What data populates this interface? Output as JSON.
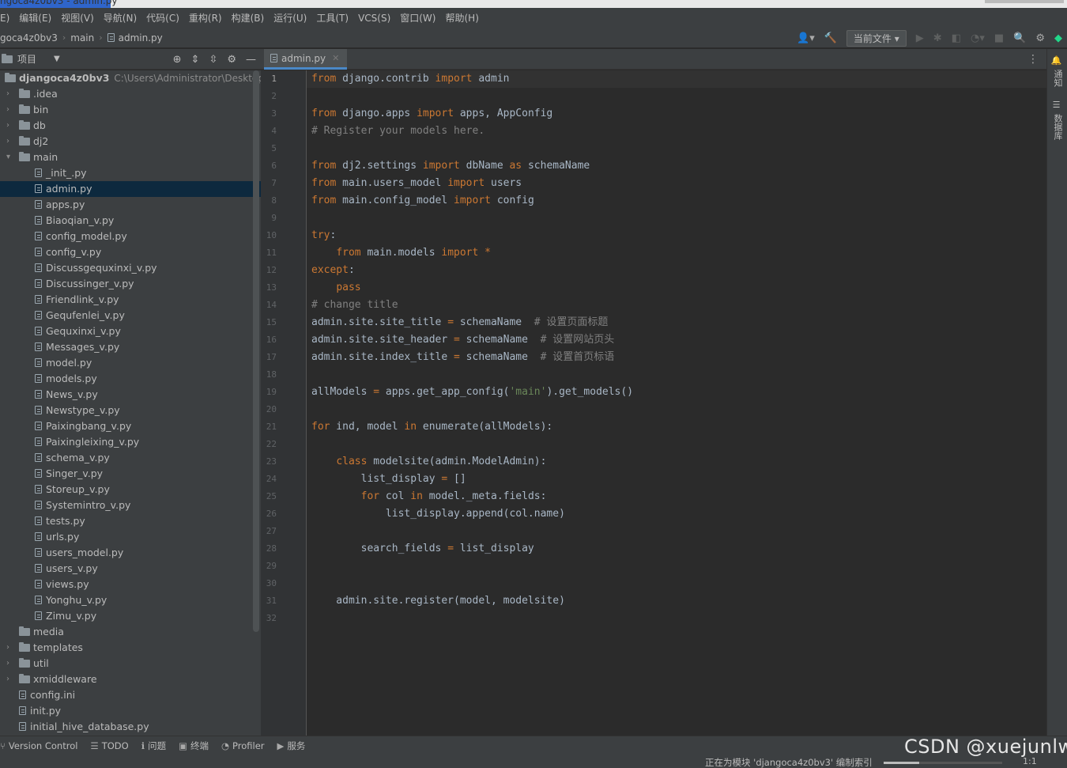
{
  "window": {
    "title": "ngoca4z0bv3 - admin.py"
  },
  "menu": [
    "E)",
    "编辑(E)",
    "视图(V)",
    "导航(N)",
    "代码(C)",
    "重构(R)",
    "构建(B)",
    "运行(U)",
    "工具(T)",
    "VCS(S)",
    "窗口(W)",
    "帮助(H)"
  ],
  "breadcrumb": {
    "project": "goca4z0bv3",
    "folder": "main",
    "file": "admin.py"
  },
  "toolbar": {
    "run_config": "当前文件"
  },
  "project_panel": {
    "title": "项目",
    "tree": [
      {
        "label": "djangoca4z0bv3",
        "path": "C:\\Users\\Administrator\\Desktop\\",
        "type": "root",
        "depth": 0,
        "arrow": "▾"
      },
      {
        "label": ".idea",
        "type": "folder",
        "depth": 1,
        "arrow": "›"
      },
      {
        "label": "bin",
        "type": "folder",
        "depth": 1,
        "arrow": "›"
      },
      {
        "label": "db",
        "type": "folder",
        "depth": 1,
        "arrow": "›"
      },
      {
        "label": "dj2",
        "type": "folder",
        "depth": 1,
        "arrow": "›"
      },
      {
        "label": "main",
        "type": "folder",
        "depth": 1,
        "arrow": "▾"
      },
      {
        "label": "_init_.py",
        "type": "file",
        "depth": 2
      },
      {
        "label": "admin.py",
        "type": "file",
        "depth": 2,
        "selected": true
      },
      {
        "label": "apps.py",
        "type": "file",
        "depth": 2
      },
      {
        "label": "Biaoqian_v.py",
        "type": "file",
        "depth": 2
      },
      {
        "label": "config_model.py",
        "type": "file",
        "depth": 2
      },
      {
        "label": "config_v.py",
        "type": "file",
        "depth": 2
      },
      {
        "label": "Discussgequxinxi_v.py",
        "type": "file",
        "depth": 2
      },
      {
        "label": "Discussinger_v.py",
        "type": "file",
        "depth": 2
      },
      {
        "label": "Friendlink_v.py",
        "type": "file",
        "depth": 2
      },
      {
        "label": "Gequfenlei_v.py",
        "type": "file",
        "depth": 2
      },
      {
        "label": "Gequxinxi_v.py",
        "type": "file",
        "depth": 2
      },
      {
        "label": "Messages_v.py",
        "type": "file",
        "depth": 2
      },
      {
        "label": "model.py",
        "type": "file",
        "depth": 2
      },
      {
        "label": "models.py",
        "type": "file",
        "depth": 2
      },
      {
        "label": "News_v.py",
        "type": "file",
        "depth": 2
      },
      {
        "label": "Newstype_v.py",
        "type": "file",
        "depth": 2
      },
      {
        "label": "Paixingbang_v.py",
        "type": "file",
        "depth": 2
      },
      {
        "label": "Paixingleixing_v.py",
        "type": "file",
        "depth": 2
      },
      {
        "label": "schema_v.py",
        "type": "file",
        "depth": 2
      },
      {
        "label": "Singer_v.py",
        "type": "file",
        "depth": 2
      },
      {
        "label": "Storeup_v.py",
        "type": "file",
        "depth": 2
      },
      {
        "label": "Systemintro_v.py",
        "type": "file",
        "depth": 2
      },
      {
        "label": "tests.py",
        "type": "file",
        "depth": 2
      },
      {
        "label": "urls.py",
        "type": "file",
        "depth": 2
      },
      {
        "label": "users_model.py",
        "type": "file",
        "depth": 2
      },
      {
        "label": "users_v.py",
        "type": "file",
        "depth": 2
      },
      {
        "label": "views.py",
        "type": "file",
        "depth": 2
      },
      {
        "label": "Yonghu_v.py",
        "type": "file",
        "depth": 2
      },
      {
        "label": "Zimu_v.py",
        "type": "file",
        "depth": 2
      },
      {
        "label": "media",
        "type": "folder",
        "depth": 1
      },
      {
        "label": "templates",
        "type": "folder",
        "depth": 1,
        "arrow": "›"
      },
      {
        "label": "util",
        "type": "folder",
        "depth": 1,
        "arrow": "›"
      },
      {
        "label": "xmiddleware",
        "type": "folder",
        "depth": 1,
        "arrow": "›"
      },
      {
        "label": "config.ini",
        "type": "file",
        "depth": 1
      },
      {
        "label": "init.py",
        "type": "file",
        "depth": 1
      },
      {
        "label": "initial_hive_database.py",
        "type": "file",
        "depth": 1
      }
    ]
  },
  "editor": {
    "tab": "admin.py",
    "current_line": 1,
    "lines": [
      [
        [
          "kw",
          "from"
        ],
        [
          "t",
          " django.contrib "
        ],
        [
          "kw",
          "import"
        ],
        [
          "t",
          " admin"
        ]
      ],
      [],
      [
        [
          "kw",
          "from"
        ],
        [
          "t",
          " django.apps "
        ],
        [
          "kw",
          "import"
        ],
        [
          "t",
          " apps, AppConfig"
        ]
      ],
      [
        [
          "cm",
          "# Register your models here."
        ]
      ],
      [],
      [
        [
          "kw",
          "from"
        ],
        [
          "t",
          " dj2.settings "
        ],
        [
          "kw",
          "import"
        ],
        [
          "t",
          " dbName "
        ],
        [
          "kw",
          "as"
        ],
        [
          "t",
          " schemaName"
        ]
      ],
      [
        [
          "kw",
          "from"
        ],
        [
          "t",
          " main.users_model "
        ],
        [
          "kw",
          "import"
        ],
        [
          "t",
          " users"
        ]
      ],
      [
        [
          "kw",
          "from"
        ],
        [
          "t",
          " main.config_model "
        ],
        [
          "kw",
          "import"
        ],
        [
          "t",
          " config"
        ]
      ],
      [],
      [
        [
          "kw",
          "try"
        ],
        [
          "t",
          ":"
        ]
      ],
      [
        [
          "t",
          "    "
        ],
        [
          "kw",
          "from"
        ],
        [
          "t",
          " main.models "
        ],
        [
          "kw",
          "import"
        ],
        [
          "t",
          " "
        ],
        [
          "kw",
          "*"
        ]
      ],
      [
        [
          "kw",
          "except"
        ],
        [
          "t",
          ":"
        ]
      ],
      [
        [
          "t",
          "    "
        ],
        [
          "kw",
          "pass"
        ]
      ],
      [
        [
          "cm",
          "# change title"
        ]
      ],
      [
        [
          "t",
          "admin.site.site_title "
        ],
        [
          "kw",
          "="
        ],
        [
          "t",
          " schemaName  "
        ],
        [
          "cm",
          "# 设置页面标题"
        ]
      ],
      [
        [
          "t",
          "admin.site.site_header "
        ],
        [
          "kw",
          "="
        ],
        [
          "t",
          " schemaName  "
        ],
        [
          "cm",
          "# 设置网站页头"
        ]
      ],
      [
        [
          "t",
          "admin.site.index_title "
        ],
        [
          "kw",
          "="
        ],
        [
          "t",
          " schemaName  "
        ],
        [
          "cm",
          "# 设置首页标语"
        ]
      ],
      [],
      [
        [
          "t",
          "allModels "
        ],
        [
          "kw",
          "="
        ],
        [
          "t",
          " apps.get_app_config("
        ],
        [
          "st",
          "'main'"
        ],
        [
          "t",
          ").get_models()"
        ]
      ],
      [],
      [
        [
          "kw",
          "for"
        ],
        [
          "t",
          " ind, model "
        ],
        [
          "kw",
          "in"
        ],
        [
          "t",
          " enumerate(allModels):"
        ]
      ],
      [],
      [
        [
          "t",
          "    "
        ],
        [
          "kw",
          "class"
        ],
        [
          "t",
          " modelsite(admin.ModelAdmin):"
        ]
      ],
      [
        [
          "t",
          "        list_display "
        ],
        [
          "kw",
          "="
        ],
        [
          "t",
          " []"
        ]
      ],
      [
        [
          "t",
          "        "
        ],
        [
          "kw",
          "for"
        ],
        [
          "t",
          " col "
        ],
        [
          "kw",
          "in"
        ],
        [
          "t",
          " model._meta.fields:"
        ]
      ],
      [
        [
          "t",
          "            list_display.append(col.name)"
        ]
      ],
      [],
      [
        [
          "t",
          "        search_fields "
        ],
        [
          "kw",
          "="
        ],
        [
          "t",
          " list_display"
        ]
      ],
      [],
      [],
      [
        [
          "t",
          "    admin.site.register(model, modelsite)"
        ]
      ],
      []
    ]
  },
  "right_sidebar": {
    "notifications": "通知",
    "database": "数据库"
  },
  "statusbar": {
    "items": [
      "Version Control",
      "TODO",
      "问题",
      "终端",
      "Profiler",
      "服务"
    ],
    "message": "正在为模块 'djangoca4z0bv3' 编制索引",
    "indexing_progress": 0.3,
    "position": "1:1"
  },
  "watermark": "CSDN @xuejunlw",
  "colors": {
    "keyword": "#cc7832",
    "comment": "#808080",
    "string": "#6a8759",
    "text": "#a9b7c6",
    "selection": "#0d293e"
  }
}
